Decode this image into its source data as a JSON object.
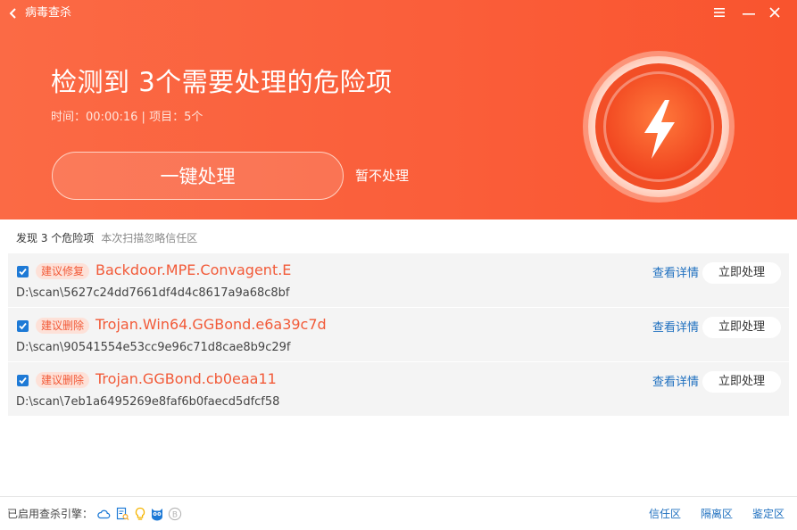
{
  "window": {
    "title": "病毒查杀",
    "back_icon": "chevron-left-icon",
    "menu_icon": "menu-icon",
    "minimize_icon": "minimize-icon",
    "close_icon": "close-icon"
  },
  "summary": {
    "headline": "检测到 3个需要处理的危险项",
    "time_label": "时间：",
    "time_value": "00:00:16",
    "separator": " | ",
    "items_label": "项目：",
    "items_value": "5个",
    "primary_button": "一键处理",
    "skip_link": "暂不处理",
    "status_icon": "lightning-bolt-icon"
  },
  "colors": {
    "header_bg": "#fa5e3a",
    "accent_red": "#f25a38",
    "link_blue": "#1e6fbf",
    "checkbox_blue": "#1e7ad6"
  },
  "list": {
    "found_text": "发现 3 个危险项",
    "trust_text": "本次扫描忽略信任区",
    "items": [
      {
        "checked": true,
        "badge": "建议修复",
        "name": "Backdoor.MPE.Convagent.E",
        "path": "D:\\scan\\5627c24dd7661df4d4c8617a9a68c8bf",
        "detail": "查看详情",
        "action": "立即处理"
      },
      {
        "checked": true,
        "badge": "建议删除",
        "name": "Trojan.Win64.GGBond.e6a39c7d",
        "path": "D:\\scan\\90541554e53cc9e96c71d8cae8b9c29f",
        "detail": "查看详情",
        "action": "立即处理"
      },
      {
        "checked": true,
        "badge": "建议删除",
        "name": "Trojan.GGBond.cb0eaa11",
        "path": "D:\\scan\\7eb1a6495269e8faf6b0faecd5dfcf58",
        "detail": "查看详情",
        "action": "立即处理"
      }
    ]
  },
  "footer": {
    "engines_label": "已启用查杀引擎：",
    "engine_icons": [
      "cloud-icon",
      "document-scan-icon",
      "bulb-icon",
      "owl-icon",
      "b-circle-icon"
    ],
    "links": [
      "信任区",
      "隔离区",
      "鉴定区"
    ]
  }
}
